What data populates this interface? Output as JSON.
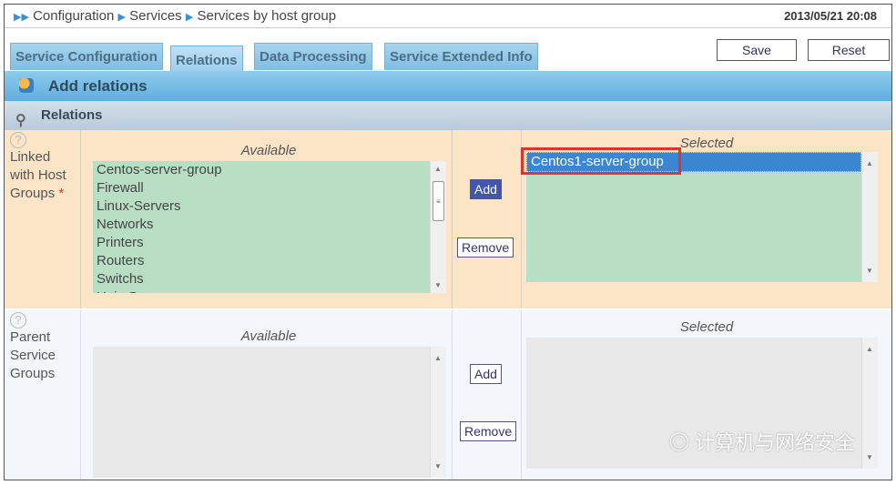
{
  "breadcrumb": [
    "Configuration",
    "Services",
    "Services by host group"
  ],
  "datetime": "2013/05/21 20:08",
  "tabs": [
    {
      "label": "Service Configuration"
    },
    {
      "label": "Relations",
      "active": true
    },
    {
      "label": "Data Processing"
    },
    {
      "label": "Service Extended Info"
    }
  ],
  "toolbar": {
    "save_label": "Save",
    "reset_label": "Reset"
  },
  "header": {
    "title": "Add relations",
    "section": "Relations"
  },
  "rows": [
    {
      "label": "Linked with Host Groups",
      "required": "*",
      "available_caption": "Available",
      "selected_caption": "Selected",
      "available": [
        "Centos-server-group",
        "Firewall",
        "Linux-Servers",
        "Networks",
        "Printers",
        "Routers",
        "Switchs",
        "Unix-Servers"
      ],
      "selected": [
        "Centos1-server-group"
      ],
      "add_label": "Add",
      "remove_label": "Remove"
    },
    {
      "label": "Parent Service Groups",
      "available_caption": "Available",
      "selected_caption": "Selected",
      "available": [],
      "selected": [],
      "add_label": "Add",
      "remove_label": "Remove"
    }
  ],
  "watermark": "计算机与网络安全",
  "colors": {
    "tab": "#8cc6e8",
    "row1": "#fbe5c6",
    "list": "#b8dfc3",
    "selected_item": "#3a86d0",
    "highlight": "#dd3333"
  }
}
